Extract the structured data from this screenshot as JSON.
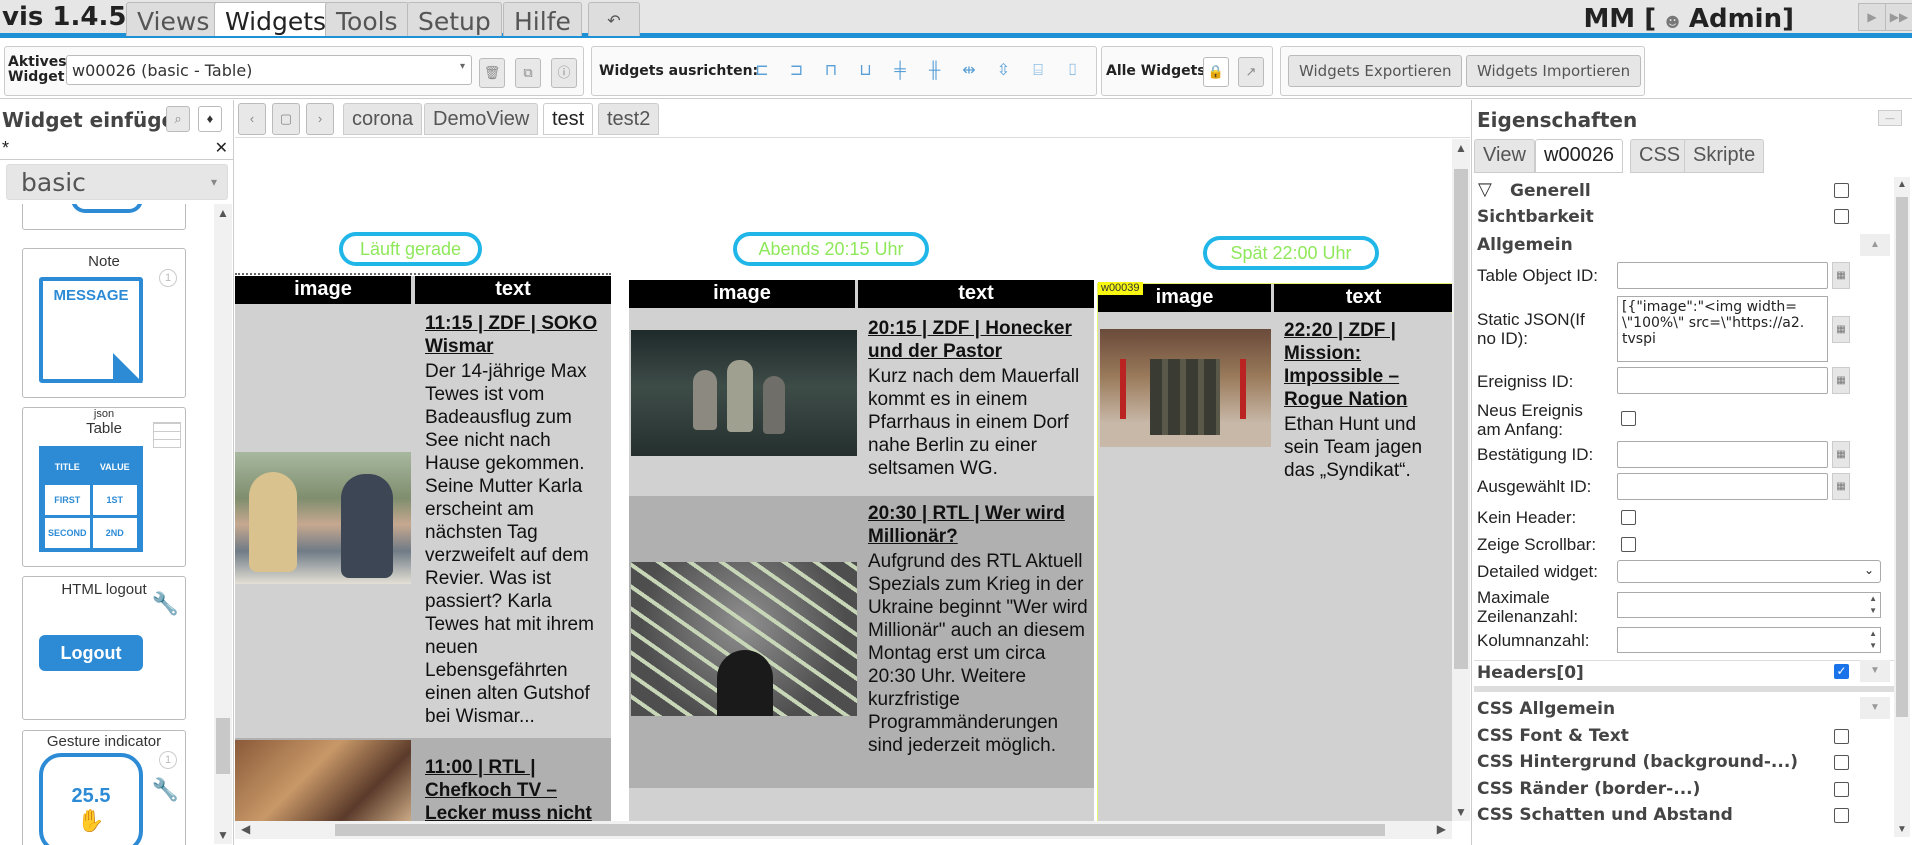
{
  "app": {
    "name": "vis 1.4.5",
    "user": "MM [",
    "user_icon": "person-icon",
    "role": "Admin]"
  },
  "menu": {
    "items": [
      "Views",
      "Widgets",
      "Tools",
      "Setup",
      "Hilfe"
    ],
    "active": "Widgets",
    "undo": "↶"
  },
  "toolbar": {
    "active_widget_label": "Aktives Widget:",
    "active_widget_value": "w00026 (basic - Table)",
    "align_label": "Widgets ausrichten:",
    "all_widgets_label": "Alle Widgets:",
    "export_label": "Widgets Exportieren",
    "import_label": "Widgets Importieren"
  },
  "left": {
    "title": "Widget einfügen",
    "filter_value": "*",
    "set_value": "basic",
    "cards": [
      {
        "name": "Note",
        "icon_text": "MESSAGE"
      },
      {
        "name_small": "json",
        "name": "Table",
        "headers": [
          "TITLE",
          "VALUE"
        ],
        "rows": [
          [
            "FIRST",
            "1ST"
          ],
          [
            "SECOND",
            "2ND"
          ]
        ]
      },
      {
        "name": "HTML logout",
        "button": "Logout"
      },
      {
        "name": "Gesture indicator",
        "value": "25.5"
      }
    ]
  },
  "views": {
    "tabs": [
      "corona",
      "DemoView",
      "test",
      "test2"
    ],
    "active": "test"
  },
  "canvas": {
    "columns": [
      {
        "pill": "Läuft gerade",
        "headers": [
          "image",
          "text"
        ],
        "rows": [
          {
            "headline": "11:15 | ZDF | SOKO Wismar",
            "text": "Der 14-jährige Max Tewes ist vom Badeausflug zum See nicht nach Hause gekommen. Seine Mutter Karla erscheint am nächsten Tag verzweifelt auf dem Revier. Was ist passiert? Karla Tewes hat mit ihrem neuen Lebensgefährten einen alten Gutshof bei Wismar..."
          },
          {
            "headline": "11:00 | RTL | Chefkoch TV – Lecker muss nicht",
            "text": ""
          }
        ]
      },
      {
        "pill": "Abends 20:15 Uhr",
        "headers": [
          "image",
          "text"
        ],
        "rows": [
          {
            "headline": "20:15 | ZDF | Honecker und der Pastor",
            "text": "Kurz nach dem Mauerfall kommt es in einem Pfarrhaus in einem Dorf nahe Berlin zu einer seltsamen WG."
          },
          {
            "headline": "20:30 | RTL | Wer wird Millionär?",
            "text": "Aufgrund des RTL Aktuell Spezials zum Krieg in der Ukraine beginnt \"Wer wird Millionär\" auch an diesem Montag erst um circa 20:30 Uhr. Weitere kurzfristige Programmänderungen sind jederzeit möglich."
          }
        ]
      },
      {
        "pill": "Spät 22:00 Uhr",
        "widget_tag": "w00039",
        "headers": [
          "image",
          "text"
        ],
        "rows": [
          {
            "headline": "22:20 | ZDF | Mission: Impossible – Rogue Nation",
            "text": "Ethan Hunt und sein Team jagen das „Syndikat“."
          }
        ]
      }
    ]
  },
  "props": {
    "title": "Eigenschaften",
    "tabs": [
      "View",
      "w00026",
      "CSS",
      "Skripte"
    ],
    "active_tab": "w00026",
    "group_generell": "Generell",
    "group_sichtbarkeit": "Sichtbarkeit",
    "group_allgemein": "Allgemein",
    "fields": {
      "table_object_id": "Table Object ID:",
      "static_json": "Static JSON(If no ID):",
      "static_json_value": "[{\"image\":\"<img width=\\\"100%\\\" src=\\\"https://a2.tvspi",
      "ereignis_id": "Ereigniss ID:",
      "neus_ereignis": "Neus Ereignis am Anfang:",
      "bestaetigung_id": "Bestätigung ID:",
      "ausgewaehlt_id": "Ausgewählt ID:",
      "kein_header": "Kein Header:",
      "zeige_scrollbar": "Zeige Scrollbar:",
      "detailed_widget": "Detailed widget:",
      "max_zeilen": "Maximale Zeilenanzahl:",
      "kolumnanzahl": "Kolumnanzahl:"
    },
    "headers_group": "Headers[0]",
    "css_groups": [
      "CSS Allgemein",
      "CSS Font & Text",
      "CSS Hintergrund (background-...)",
      "CSS Ränder (border-...)",
      "CSS Schatten und Abstand"
    ]
  }
}
